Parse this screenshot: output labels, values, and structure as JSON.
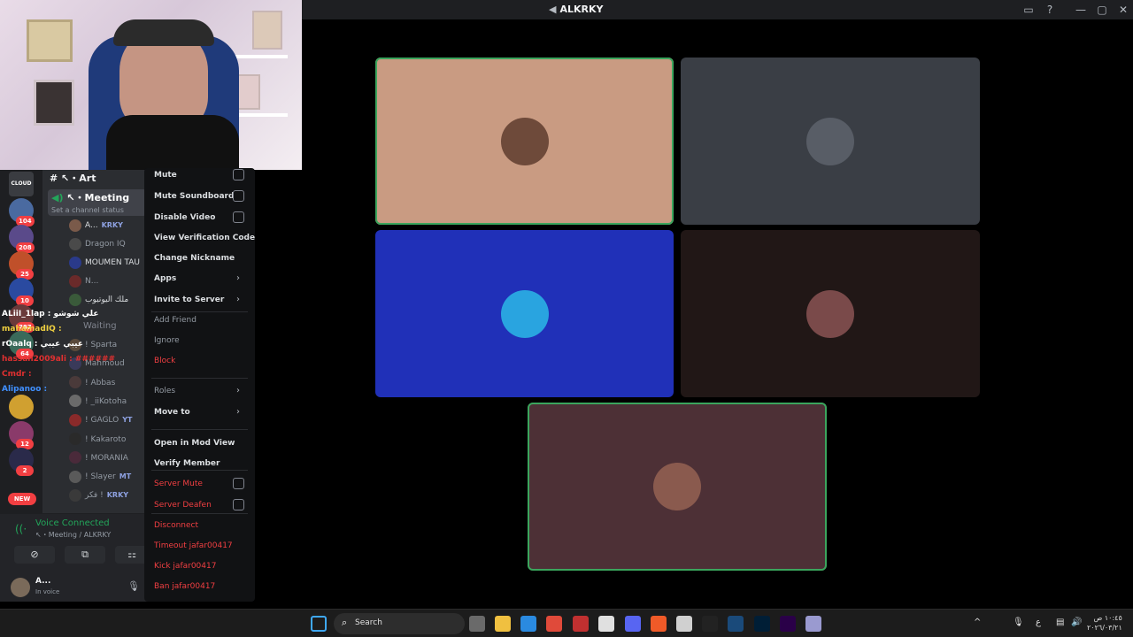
{
  "window": {
    "title": "ALKRKY",
    "title_icon": "speaker-icon"
  },
  "stage": {
    "tiles": [
      {
        "name": "participant-1",
        "bg": "#c99b82",
        "speaking": true,
        "avatar": "#6e4a3a"
      },
      {
        "name": "participant-2",
        "bg": "#3a3e45",
        "speaking": false,
        "avatar": "#585d66"
      },
      {
        "name": "participant-3",
        "bg": "#2030b8",
        "speaking": false,
        "avatar": "#29a4e0"
      },
      {
        "name": "participant-4",
        "bg": "#211716",
        "speaking": false,
        "avatar": "#7a4a4a"
      },
      {
        "name": "participant-5",
        "bg": "#4d3036",
        "speaking": true,
        "avatar": "#8a5a4e"
      }
    ]
  },
  "servers": [
    {
      "label": "CLOUD",
      "color": "#3a3c41"
    },
    {
      "badge": "104",
      "color": "#4a6aa0"
    },
    {
      "badge": "208",
      "color": "#5a4a8a"
    },
    {
      "badge": "25",
      "color": "#c0502a"
    },
    {
      "badge": "10",
      "color": "#2a4aa0"
    },
    {
      "badge": "787",
      "color": "#6a3a3a"
    },
    {
      "badge": "64",
      "color": "#3a6a5a"
    },
    {
      "badge": "",
      "color": "#d0a030"
    },
    {
      "badge": "12",
      "color": "#8a3a6a"
    },
    {
      "badge": "2",
      "color": "#2a2a4a"
    }
  ],
  "new_badge": "NEW",
  "channels": {
    "art": "↖・Art",
    "meeting": "↖・Meeting",
    "meeting_status": "Set a channel status",
    "members": [
      {
        "name": "A...",
        "tag": "KRKY",
        "bright": true,
        "color": "#7a5a4a"
      },
      {
        "name": "Dragon IQ",
        "tag": "",
        "bright": false,
        "color": "#4a4a4a"
      },
      {
        "name": "MOUMEN TAU",
        "tag": "",
        "bright": true,
        "color": "#2a3a8a"
      },
      {
        "name": "N...",
        "tag": "",
        "bright": false,
        "color": "#6a2a2a"
      },
      {
        "name": "ملك اليوتيوب",
        "tag": "",
        "bright": true,
        "color": "#3a5a3a"
      }
    ],
    "waiting": "Waiting",
    "waiting_members": [
      {
        "name": "! Sparta",
        "color": "#5a4a3a"
      },
      {
        "name": "Mahmoud",
        "color": "#3a3a5a"
      },
      {
        "name": "! Abbas",
        "color": "#4a3a3a"
      },
      {
        "name": "! _iiKotoha",
        "color": "#6a6a6a"
      },
      {
        "name": "! GAGLO",
        "tag": "YT",
        "color": "#8a2a2a"
      },
      {
        "name": "! Kakaroto",
        "color": "#2a2a2a"
      },
      {
        "name": "! MORANIA",
        "color": "#4a2a3a"
      },
      {
        "name": "! Slayer",
        "tag": "MT",
        "color": "#5a5a5a"
      },
      {
        "name": "فكر !",
        "tag": "KRKY",
        "color": "#3a3a3a"
      }
    ]
  },
  "chat_overlay": [
    {
      "text": "ALiiI_1lap : علي شوشو",
      "color": "#ffffff"
    },
    {
      "text": "mahamadIQ :",
      "color": "#f0d040"
    },
    {
      "text": "rOaalq : عيبي عيبي",
      "color": "#ffffff"
    },
    {
      "text": "hassan2009ali : ######",
      "color": "#e03030"
    },
    {
      "text": "Cmdr :",
      "color": "#e03030"
    },
    {
      "text": "Alipanoo :",
      "color": "#4090ff"
    }
  ],
  "voice": {
    "status": "Voice Connected",
    "channel": "↖・Meeting / ALKRKY",
    "buttons": [
      "camera-off-icon",
      "screen-share-icon",
      "activity-icon"
    ],
    "user_name": "A...",
    "user_status": "In voice"
  },
  "context_menu": {
    "items": [
      {
        "label": "Mute",
        "style": "normal",
        "control": "check"
      },
      {
        "label": "Mute Soundboard",
        "style": "normal",
        "control": "check"
      },
      {
        "label": "Disable Video",
        "style": "normal",
        "control": "check"
      },
      {
        "label": "View Verification Code",
        "style": "normal",
        "control": ""
      },
      {
        "label": "Change Nickname",
        "style": "normal",
        "control": ""
      },
      {
        "label": "Apps",
        "style": "normal",
        "control": "arrow"
      },
      {
        "label": "Invite to Server",
        "style": "normal",
        "control": "arrow"
      },
      {
        "label": "Add Friend",
        "style": "dim",
        "control": ""
      },
      {
        "label": "Ignore",
        "style": "dim",
        "control": ""
      },
      {
        "label": "Block",
        "style": "danger",
        "control": ""
      },
      {
        "label": "Roles",
        "style": "dim",
        "control": "arrow"
      },
      {
        "label": "Move to",
        "style": "normal",
        "control": "arrow"
      },
      {
        "label": "Open in Mod View",
        "style": "normal",
        "control": ""
      },
      {
        "label": "Verify Member",
        "style": "normal",
        "control": ""
      },
      {
        "label": "Server Mute",
        "style": "danger",
        "control": "check"
      },
      {
        "label": "Server Deafen",
        "style": "danger",
        "control": "check"
      },
      {
        "label": "Disconnect",
        "style": "danger",
        "control": ""
      },
      {
        "label": "Timeout jafar00417",
        "style": "danger",
        "control": ""
      },
      {
        "label": "Kick jafar00417",
        "style": "danger",
        "control": ""
      },
      {
        "label": "Ban jafar00417",
        "style": "danger",
        "control": ""
      }
    ]
  },
  "taskbar": {
    "search_placeholder": "Search",
    "apps": [
      {
        "name": "start-button",
        "color": "#3fa8f4"
      },
      {
        "name": "task-view-icon",
        "color": "#6a6a6a"
      },
      {
        "name": "file-explorer-icon",
        "color": "#f0c040"
      },
      {
        "name": "store-icon",
        "color": "#2a8ae0"
      },
      {
        "name": "chrome-icon",
        "color": "#e04a3a"
      },
      {
        "name": "app-icon-red",
        "color": "#c03030"
      },
      {
        "name": "obs-icon",
        "color": "#e0e0e0"
      },
      {
        "name": "discord-icon",
        "color": "#5865f2"
      },
      {
        "name": "brave-icon",
        "color": "#f05a28"
      },
      {
        "name": "app-icon",
        "color": "#d0d0d0"
      },
      {
        "name": "capcut-icon",
        "color": "#222222"
      },
      {
        "name": "steam-icon",
        "color": "#1a4a7a"
      },
      {
        "name": "photoshop-icon",
        "color": "#001e36"
      },
      {
        "name": "premiere-icon",
        "color": "#2a0048"
      },
      {
        "name": "app-icon-2",
        "color": "#9a9ad0"
      }
    ],
    "tray_lang": "ع",
    "time": "١٠:٤٥ ص",
    "date": "٢٠٢٦/٠٣/٢١"
  }
}
